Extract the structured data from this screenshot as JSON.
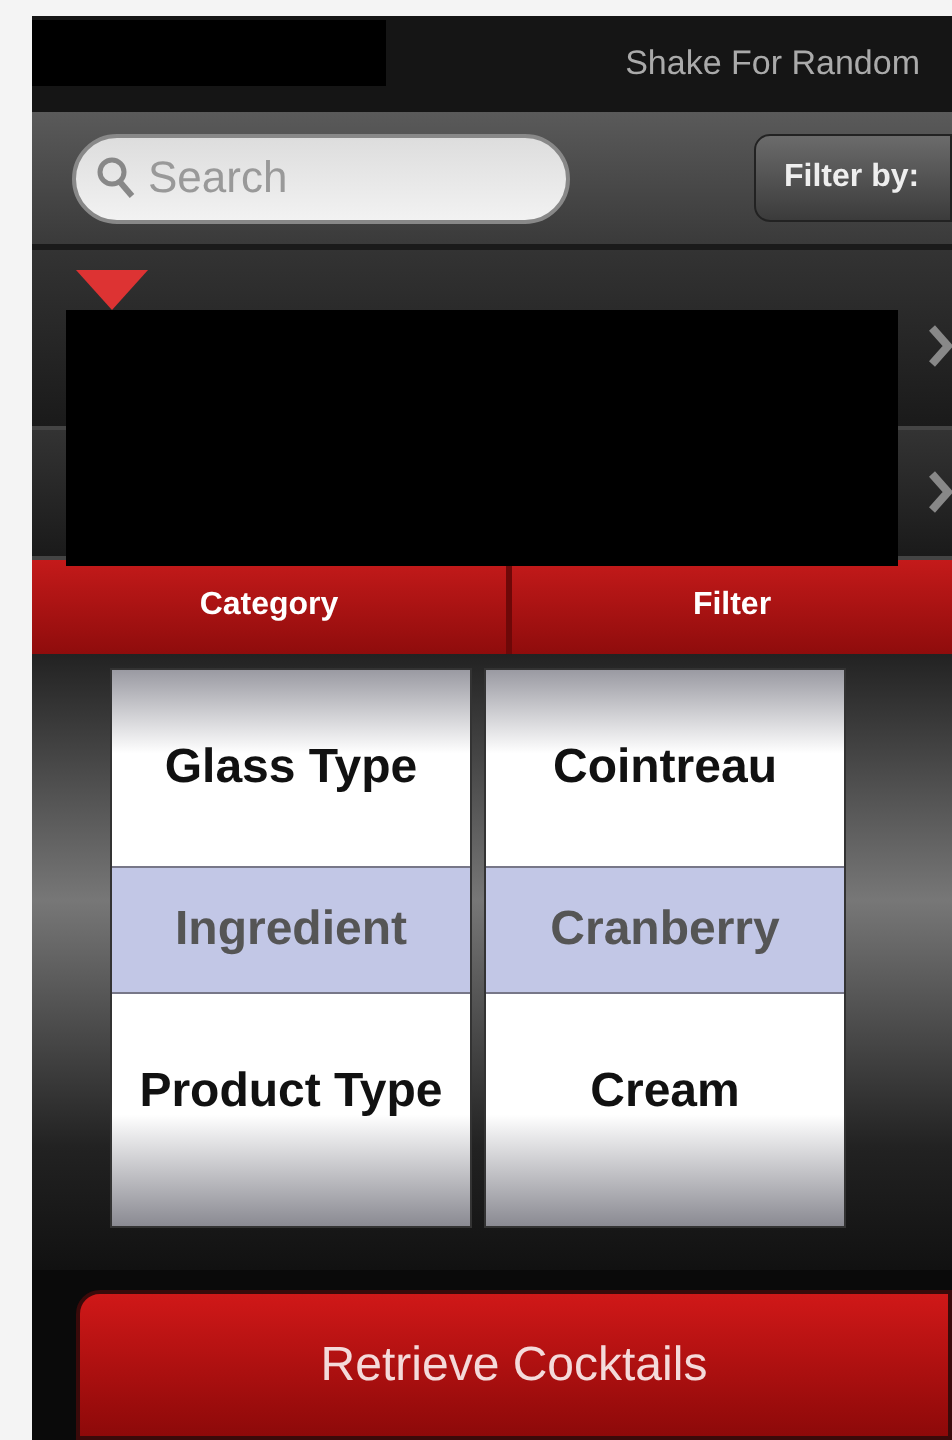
{
  "header": {
    "title": "Shake For Random"
  },
  "search": {
    "placeholder": "Search"
  },
  "filter_button": "Filter by:",
  "picker": {
    "columns": [
      {
        "heading": "Category",
        "items": [
          {
            "label": "Glass Type",
            "selected": false
          },
          {
            "label": "Ingredient",
            "selected": true
          },
          {
            "label": "Product Type",
            "selected": false
          }
        ]
      },
      {
        "heading": "Filter",
        "items": [
          {
            "label": "Cointreau",
            "selected": false
          },
          {
            "label": "Cranberry",
            "selected": true
          },
          {
            "label": "Cream",
            "selected": false
          }
        ]
      }
    ]
  },
  "action_button": "Retrieve Cocktails"
}
